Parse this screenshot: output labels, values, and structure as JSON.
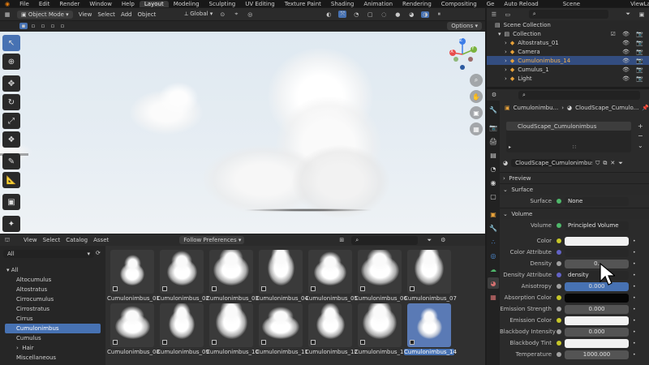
{
  "menubar": {
    "items": [
      "File",
      "Edit",
      "Render",
      "Window",
      "Help"
    ],
    "workspaces": [
      "Layout",
      "Modeling",
      "Sculpting",
      "UV Editing",
      "Texture Paint",
      "Shading",
      "Animation",
      "Rendering",
      "Compositing",
      "Ge"
    ],
    "active_workspace": "Layout",
    "auto_reload": "Auto Reload",
    "scene": "Scene",
    "view_layer": "ViewLayer"
  },
  "viewport_header": {
    "mode": "Object Mode",
    "menus": [
      "View",
      "Select",
      "Add",
      "Object"
    ],
    "orientation": "Global",
    "options": "Options"
  },
  "gizmo": {
    "x": "X",
    "y": "Y",
    "z": "Z"
  },
  "outliner": {
    "root": "Scene Collection",
    "collection": "Collection",
    "items": [
      {
        "name": "Altostratus_01",
        "selected": false
      },
      {
        "name": "Camera",
        "selected": false
      },
      {
        "name": "Cumulonimbus_14",
        "selected": true
      },
      {
        "name": "Cumulus_1",
        "selected": false
      },
      {
        "name": "Light",
        "selected": false
      }
    ]
  },
  "properties": {
    "breadcrumb_object": "Cumulonimbu...",
    "breadcrumb_material": "CloudScape_Cumulo...",
    "slot": "CloudScape_Cumulonimbus",
    "material_name": "CloudScape_Cumulonimbus",
    "sections": {
      "preview": "Preview",
      "surface": "Surface",
      "volume": "Volume"
    },
    "surface": {
      "label": "Surface",
      "value": "None"
    },
    "volume": {
      "label": "Volume",
      "value": "Principled Volume"
    },
    "rows": [
      {
        "label": "Color",
        "value": "",
        "dot": "#c7c729",
        "type": "white"
      },
      {
        "label": "Color Attribute",
        "value": "",
        "dot": "#6363c7",
        "type": "dark"
      },
      {
        "label": "Density",
        "value": "0.",
        "dot": "#a1a1a1",
        "type": "num"
      },
      {
        "label": "Density Attribute",
        "value": "density",
        "dot": "#6363c7",
        "type": "dark"
      },
      {
        "label": "Anisotropy",
        "value": "0.000",
        "dot": "#a1a1a1",
        "type": "blue"
      },
      {
        "label": "Absorption Color",
        "value": "",
        "dot": "#c7c729",
        "type": "black"
      },
      {
        "label": "Emission Strength",
        "value": "0.000",
        "dot": "#a1a1a1",
        "type": "num"
      },
      {
        "label": "Emission Color",
        "value": "",
        "dot": "#c7c729",
        "type": "white"
      },
      {
        "label": "Blackbody Intensity",
        "value": "0.000",
        "dot": "#a1a1a1",
        "type": "num"
      },
      {
        "label": "Blackbody Tint",
        "value": "",
        "dot": "#c7c729",
        "type": "white"
      },
      {
        "label": "Temperature",
        "value": "1000.000",
        "dot": "#a1a1a1",
        "type": "num"
      }
    ]
  },
  "asset_browser": {
    "menus": [
      "View",
      "Select",
      "Catalog",
      "Asset"
    ],
    "import_method": "Follow Preferences",
    "library": "All",
    "catalog_root": "All",
    "catalogs": [
      {
        "name": "Altocumulus",
        "selected": false
      },
      {
        "name": "Altostratus",
        "selected": false
      },
      {
        "name": "Cirrocumulus",
        "selected": false
      },
      {
        "name": "Cirrostratus",
        "selected": false
      },
      {
        "name": "Cirrus",
        "selected": false
      },
      {
        "name": "Cumulonimbus",
        "selected": true
      },
      {
        "name": "Cumulus",
        "selected": false
      },
      {
        "name": "Hair",
        "selected": false,
        "child": true
      },
      {
        "name": "Miscellaneous",
        "selected": false
      }
    ],
    "assets": [
      {
        "name": "Cumulonimbus_01",
        "selected": false
      },
      {
        "name": "Cumulonimbus_02",
        "selected": false
      },
      {
        "name": "Cumulonimbus_03",
        "selected": false
      },
      {
        "name": "Cumulonimbus_04",
        "selected": false
      },
      {
        "name": "Cumulonimbus_05",
        "selected": false
      },
      {
        "name": "Cumulonimbus_06",
        "selected": false
      },
      {
        "name": "Cumulonimbus_07",
        "selected": false
      },
      {
        "name": "Cumulonimbus_08",
        "selected": false
      },
      {
        "name": "Cumulonimbus_09",
        "selected": false
      },
      {
        "name": "Cumulonimbus_10",
        "selected": false
      },
      {
        "name": "Cumulonimbus_11",
        "selected": false
      },
      {
        "name": "Cumulonimbus_12",
        "selected": false
      },
      {
        "name": "Cumulonimbus_13",
        "selected": false
      },
      {
        "name": "Cumulonimbus_14",
        "selected": true
      }
    ]
  },
  "colors": {
    "accent": "#4772b3",
    "selected_row": "#334d80",
    "header": "#2b2b2b",
    "panel": "#1d1d1d"
  }
}
